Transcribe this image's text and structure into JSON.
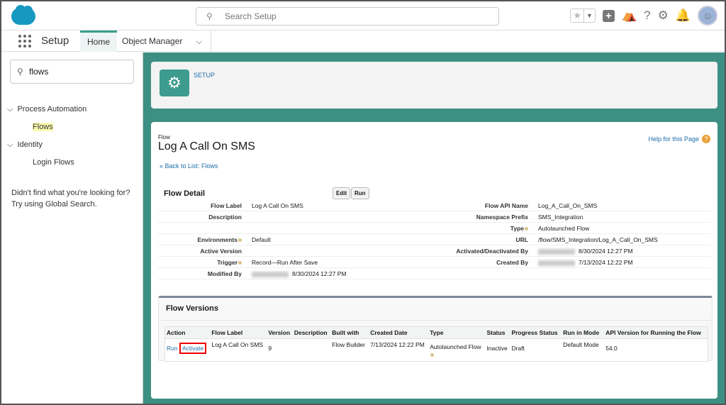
{
  "header": {
    "search_placeholder": "Search Setup",
    "icons": [
      "star-icon",
      "chevron-down-icon",
      "plus-icon",
      "trailhead-icon",
      "help-icon",
      "gear-icon",
      "bell-icon",
      "avatar"
    ]
  },
  "nav": {
    "app": "Setup",
    "tabs": [
      {
        "label": "Home"
      },
      {
        "label": "Object Manager"
      }
    ]
  },
  "sidebar": {
    "search_value": "flows",
    "groups": [
      {
        "label": "Process Automation",
        "items": [
          "Flows"
        ]
      },
      {
        "label": "Identity",
        "items": [
          "Login Flows"
        ]
      }
    ],
    "hint1": "Didn't find what you're looking for?",
    "hint2": "Try using Global Search."
  },
  "banner": {
    "label": "SETUP"
  },
  "page": {
    "type": "Flow",
    "title": "Log A Call On SMS",
    "help": "Help for this Page",
    "back": "« Back to List: Flows"
  },
  "detail": {
    "title": "Flow Detail",
    "edit": "Edit",
    "run": "Run",
    "left": [
      [
        "Flow Label",
        "Log A Call On SMS"
      ],
      [
        "Description",
        ""
      ],
      [
        "",
        ""
      ],
      [
        "Environments",
        "Default"
      ],
      [
        "Active Version",
        ""
      ],
      [
        "Trigger",
        "Record—Run After Save"
      ],
      [
        "Modified By",
        "8/30/2024 12:27 PM"
      ]
    ],
    "right": [
      [
        "Flow API Name",
        "Log_A_Call_On_SMS"
      ],
      [
        "Namespace Prefix",
        "SMS_Integration"
      ],
      [
        "Type",
        "Autolaunched Flow"
      ],
      [
        "URL",
        "/flow/SMS_Integration/Log_A_Call_On_SMS"
      ],
      [
        "Activated/Deactivated By",
        "8/30/2024 12:27 PM"
      ],
      [
        "Created By",
        "7/13/2024 12:22 PM"
      ],
      [
        "",
        ""
      ]
    ]
  },
  "versions": {
    "title": "Flow Versions",
    "columns": [
      "Action",
      "Flow Label",
      "Version",
      "Description",
      "Built with",
      "Created Date",
      "Type",
      "Status",
      "Progress Status",
      "Run in Mode",
      "API Version for Running the Flow"
    ],
    "row": {
      "run": "Run",
      "activate": "Activate",
      "label": "Log A Call On SMS",
      "version": "9",
      "description": "",
      "built": "Flow Builder",
      "created": "7/13/2024 12:22 PM",
      "type": "Autolaunched Flow",
      "status": "Inactive",
      "progress": "Draft",
      "mode": "Default Mode",
      "api": "54.0"
    }
  },
  "colors": {
    "teal": "#3d8f83",
    "link": "#1b6dab",
    "highlight": "#e00000"
  }
}
